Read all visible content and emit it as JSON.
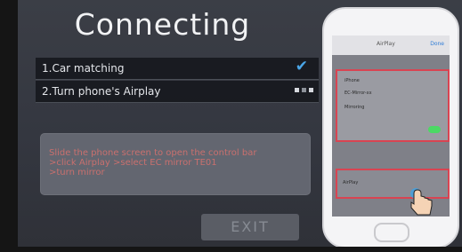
{
  "title": "Connecting",
  "steps": [
    {
      "label": "1.Car matching",
      "status": "done"
    },
    {
      "label": "2.Turn phone's Airplay",
      "status": "in-progress"
    }
  ],
  "hint": {
    "line1": "Slide the phone screen to open the control bar",
    "line2": ">click Airplay >select EC mirror TE01",
    "line3": ">turn mirror"
  },
  "exit_label": "EXIT",
  "phone": {
    "header_title": "AirPlay",
    "header_done": "Done",
    "row1": "iPhone",
    "row2": "EC-Mirror-xx",
    "row3": "Mirroring",
    "bar_label": "AirPlay"
  },
  "colors": {
    "accent_check": "#4aa6e8",
    "highlight_red": "#d94452",
    "hint_text": "#c9706e"
  }
}
